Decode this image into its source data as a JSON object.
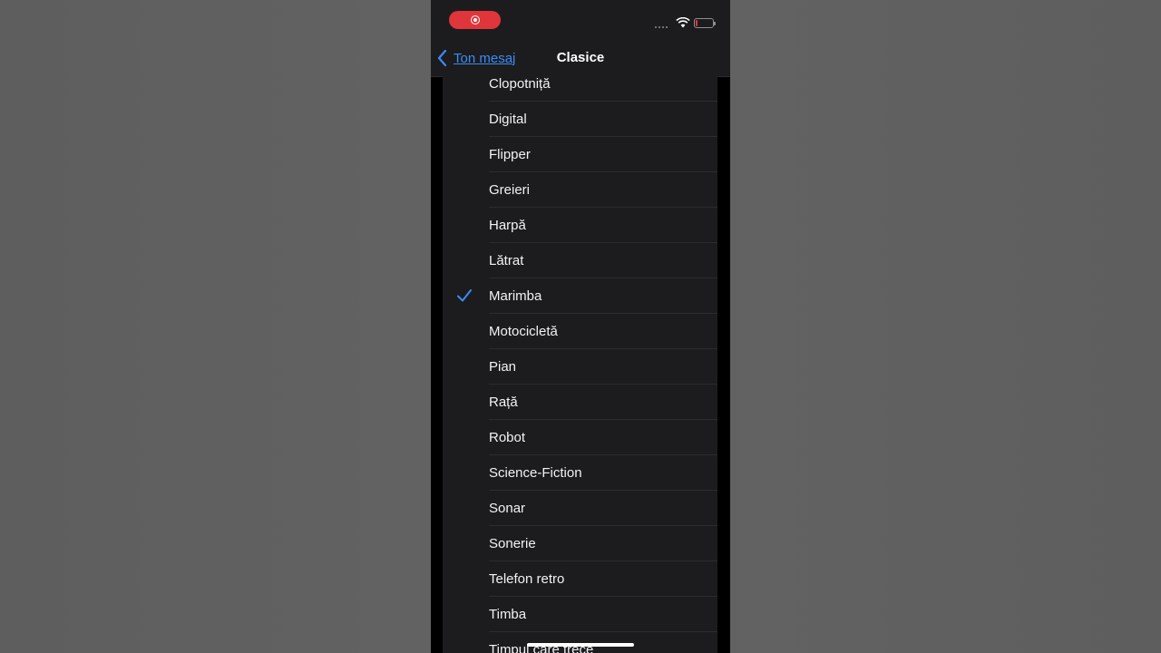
{
  "status": {
    "recording_icon": "screen-record-icon",
    "wifi_icon": "wifi-icon",
    "battery_icon": "battery-low-icon",
    "accent_red": "#e0353b"
  },
  "nav": {
    "back_label": "Ton mesaj",
    "back_icon": "chevron-left-icon",
    "title": "Clasice",
    "accent": "#3b8cf4"
  },
  "list": {
    "selected_icon": "checkmark-icon",
    "items": [
      {
        "label": "Clopotniță",
        "selected": false
      },
      {
        "label": "Digital",
        "selected": false
      },
      {
        "label": "Flipper",
        "selected": false
      },
      {
        "label": "Greieri",
        "selected": false
      },
      {
        "label": "Harpă",
        "selected": false
      },
      {
        "label": "Lătrat",
        "selected": false
      },
      {
        "label": "Marimba",
        "selected": true
      },
      {
        "label": "Motocicletă",
        "selected": false
      },
      {
        "label": "Pian",
        "selected": false
      },
      {
        "label": "Rață",
        "selected": false
      },
      {
        "label": "Robot",
        "selected": false
      },
      {
        "label": "Science-Fiction",
        "selected": false
      },
      {
        "label": "Sonar",
        "selected": false
      },
      {
        "label": "Sonerie",
        "selected": false
      },
      {
        "label": "Telefon retro",
        "selected": false
      },
      {
        "label": "Timba",
        "selected": false
      },
      {
        "label": "Timpul care trece",
        "selected": false
      }
    ]
  }
}
